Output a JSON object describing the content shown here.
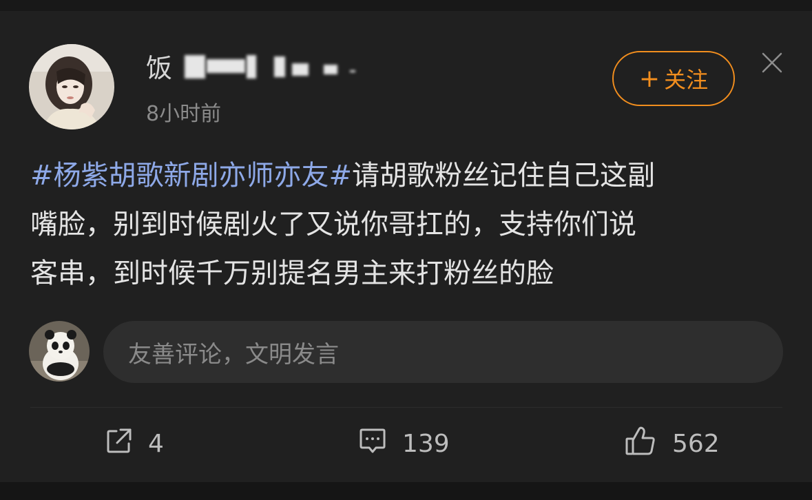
{
  "post": {
    "username_visible_prefix": "饭",
    "timestamp": "8小时前",
    "follow_label": "关注",
    "follow_plus": "+",
    "text_lines": [
      {
        "hashtag": "#杨紫胡歌新剧亦师亦友#",
        "text": "请胡歌粉丝记住自己这副"
      },
      {
        "hashtag": "",
        "text": "嘴脸，别到时候剧火了又说你哥扛的，支持你们说"
      },
      {
        "hashtag": "",
        "text": "客串，到时候千万别提名男主来打粉丝的脸"
      }
    ]
  },
  "comment": {
    "placeholder": "友善评论，文明发言"
  },
  "actions": {
    "share_count": "4",
    "comment_count": "139",
    "like_count": "562"
  },
  "colors": {
    "accent_orange": "#f28e1e",
    "hashtag_blue": "#8ea9e8",
    "background": "#202020"
  },
  "icons": {
    "share": "share-icon",
    "comment": "comment-icon",
    "like": "thumbs-up-icon",
    "close": "close-icon"
  }
}
